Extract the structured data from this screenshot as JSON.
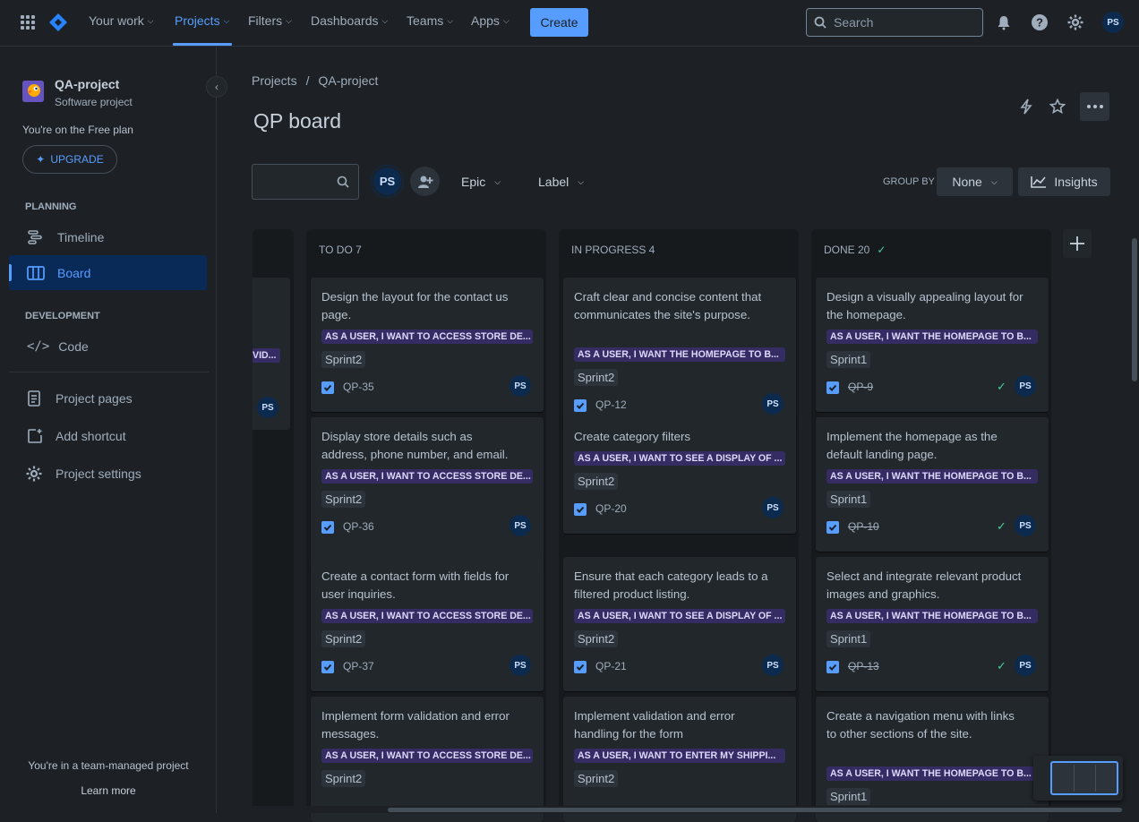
{
  "topnav": {
    "items": [
      "Your work",
      "Projects",
      "Filters",
      "Dashboards",
      "Teams",
      "Apps"
    ],
    "create_label": "Create",
    "search_placeholder": "Search",
    "avatar": "PS",
    "colors": {
      "accent": "#579dff",
      "bg": "#1d2125"
    }
  },
  "sidebar": {
    "project_name": "QA-project",
    "project_type": "Software project",
    "plan_text": "You're on the Free plan",
    "upgrade_label": "UPGRADE",
    "planning_heading": "PLANNING",
    "timeline_label": "Timeline",
    "board_label": "Board",
    "development_heading": "DEVELOPMENT",
    "code_label": "Code",
    "project_pages_label": "Project pages",
    "add_shortcut_label": "Add shortcut",
    "project_settings_label": "Project settings",
    "footer_text": "You're in a team-managed project",
    "learn_more_label": "Learn more"
  },
  "header": {
    "breadcrumb_projects": "Projects",
    "breadcrumb_sep": "/",
    "breadcrumb_project": "QA-project",
    "title": "QP board"
  },
  "toolbar": {
    "avatar": "PS",
    "epic_label": "Epic",
    "label_label": "Label",
    "group_by_label": "GROUP BY",
    "group_by_value": "None",
    "insights_label": "Insights"
  },
  "partial_column": {
    "epic_fragment": "VID...",
    "avatar": "PS"
  },
  "columns": [
    {
      "title": "TO DO 7",
      "cards": [
        {
          "title": "Design the layout for the contact us page.",
          "epic": "AS A USER, I WANT TO ACCESS STORE DE...",
          "sprint": "Sprint2",
          "key": "QP-35",
          "done": false,
          "avatar": "PS"
        },
        {
          "title": "Display store details such as address, phone number, and email.",
          "epic": "AS A USER, I WANT TO ACCESS STORE DE...",
          "sprint": "Sprint2",
          "key": "QP-36",
          "done": false,
          "avatar": "PS"
        },
        {
          "title": "Create a contact form with fields for user inquiries.",
          "epic": "AS A USER, I WANT TO ACCESS STORE DE...",
          "sprint": "Sprint2",
          "key": "QP-37",
          "done": false,
          "avatar": "PS"
        },
        {
          "title": "Implement form validation and error messages.",
          "epic": "AS A USER, I WANT TO ACCESS STORE DE...",
          "sprint": "Sprint2",
          "key": "",
          "done": false,
          "avatar": ""
        }
      ]
    },
    {
      "title": "IN PROGRESS 4",
      "cards": [
        {
          "title": "Craft clear and concise content that communicates the site's purpose.",
          "epic": "AS A USER, I WANT THE HOMEPAGE TO B...",
          "sprint": "Sprint2",
          "key": "QP-12",
          "done": false,
          "avatar": "PS"
        },
        {
          "title": "Create category filters",
          "epic": "AS A USER, I WANT TO SEE A DISPLAY OF ...",
          "sprint": "Sprint2",
          "key": "QP-20",
          "done": false,
          "avatar": "PS"
        },
        {
          "title": "Ensure that each category leads to a filtered product listing.",
          "epic": "AS A USER, I WANT TO SEE A DISPLAY OF ...",
          "sprint": "Sprint2",
          "key": "QP-21",
          "done": false,
          "avatar": "PS"
        },
        {
          "title": "Implement validation and error handling for the form",
          "epic": "AS A USER, I WANT TO ENTER MY SHIPPI...",
          "sprint": "Sprint2",
          "key": "",
          "done": false,
          "avatar": ""
        }
      ]
    },
    {
      "title": "DONE 20",
      "cards": [
        {
          "title": "Design a visually appealing layout for the homepage.",
          "epic": "AS A USER, I WANT THE HOMEPAGE TO B...",
          "sprint": "Sprint1",
          "key": "QP-9",
          "done": true,
          "avatar": "PS"
        },
        {
          "title": "Implement the homepage as the default landing page.",
          "epic": "AS A USER, I WANT THE HOMEPAGE TO B...",
          "sprint": "Sprint1",
          "key": "QP-10",
          "done": true,
          "avatar": "PS"
        },
        {
          "title": "Select and integrate relevant product images and graphics.",
          "epic": "AS A USER, I WANT THE HOMEPAGE TO B...",
          "sprint": "Sprint1",
          "key": "QP-13",
          "done": true,
          "avatar": "PS"
        },
        {
          "title": "Create a navigation menu with links to other sections of the site.",
          "epic": "AS A USER, I WANT THE HOMEPAGE TO B...",
          "sprint": "Sprint1",
          "key": "",
          "done": true,
          "avatar": ""
        }
      ]
    }
  ]
}
